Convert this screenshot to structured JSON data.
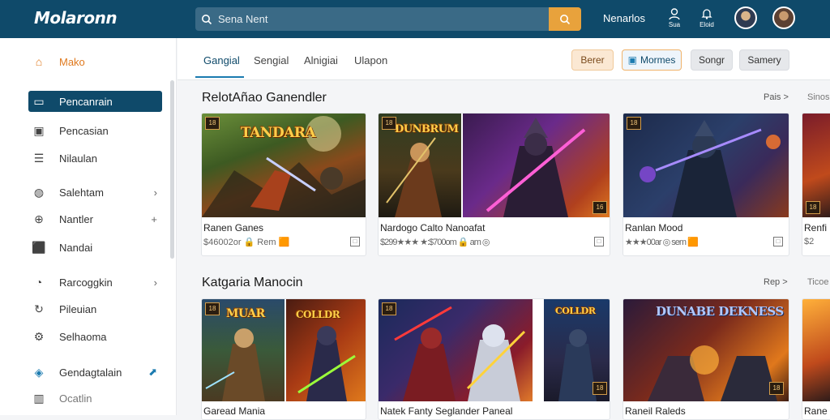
{
  "header": {
    "logo": "Molaronn",
    "search_placeholder": "Sena Nent",
    "nav_label": "Nenarlos",
    "icon1_label": "Sua",
    "icon2_label": "Eloid"
  },
  "sidebar": {
    "items": [
      {
        "label": "Mako",
        "icon": "home-icon"
      },
      {
        "label": "Pencanrain",
        "icon": "folder-icon"
      },
      {
        "label": "Pencasian",
        "icon": "square-icon"
      },
      {
        "label": "Nilaulan",
        "icon": "list-icon"
      },
      {
        "label": "Salehtam",
        "icon": "globe-icon",
        "trail": "›"
      },
      {
        "label": "Nantler",
        "icon": "compass-icon",
        "trail": "+"
      },
      {
        "label": "Nandai",
        "icon": "cube-icon"
      },
      {
        "label": "Rarcoggkin",
        "icon": "drop-icon",
        "trail": "›"
      },
      {
        "label": "Pileuian",
        "icon": "refresh-icon"
      },
      {
        "label": "Selhaoma",
        "icon": "gear-icon"
      },
      {
        "label": "Gendagtalain",
        "icon": "tag-icon",
        "trail": "⬈"
      },
      {
        "label": "Ocatlin",
        "icon": "bar-icon"
      }
    ]
  },
  "tabs": [
    "Gangial",
    "Sengial",
    "Alnigiai",
    "Ulapon"
  ],
  "pills": [
    "Berer",
    "Mormes",
    "Songr",
    "Samery"
  ],
  "sections": [
    {
      "title": "RelotAñao Ganendler",
      "more": "Pais >",
      "more2": "Sinos"
    },
    {
      "title": "Katgaria Manocin",
      "more": "Rep >",
      "more2": "Ticoe"
    }
  ],
  "row1": [
    {
      "thumb_text": "TANDARA",
      "title": "Ranen Ganes",
      "meta": "$46002or  🔒 Rem 🟧"
    },
    {
      "thumb_text": "DUNBRUM",
      "title": "Nardogo Calto Nanoafat",
      "meta": "$299★★★ ★:$700om 🔒 am ◎"
    },
    {
      "thumb_text": "",
      "title": "Ranlan Mood",
      "meta": "★★★00ar  ◎ sem 🟧"
    },
    {
      "thumb_text": "",
      "title": "Renfi",
      "meta": "$2"
    }
  ],
  "row2": [
    {
      "thumb_text": "MUAR",
      "title": "Garead Mania"
    },
    {
      "thumb_text": "COLLDR",
      "title": "Natek Fanty Seglander Paneal"
    },
    {
      "thumb_text": "DUNABE DEKNESS",
      "title": "Raneil Raleds"
    },
    {
      "thumb_text": "",
      "title": "Rane"
    }
  ]
}
